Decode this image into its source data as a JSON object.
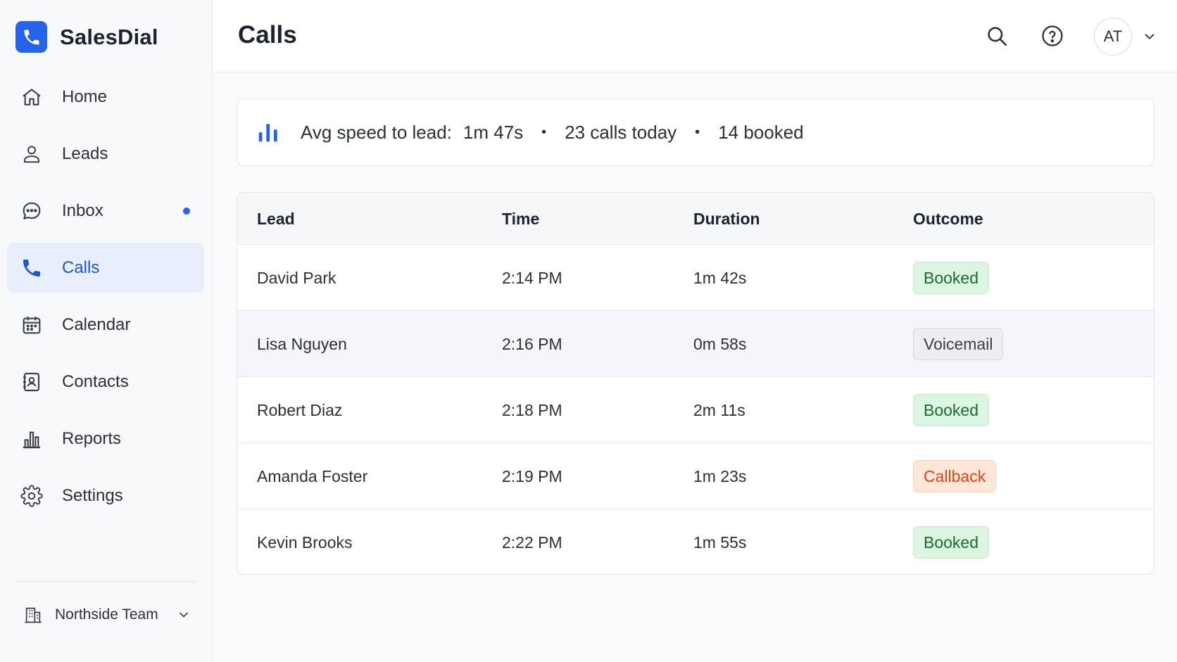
{
  "app": {
    "name": "SalesDial",
    "brand_color": "#2563eb"
  },
  "sidebar": {
    "items": [
      {
        "label": "Home",
        "icon": "home-icon",
        "active": false
      },
      {
        "label": "Leads",
        "icon": "user-icon",
        "active": false
      },
      {
        "label": "Inbox",
        "icon": "chat-icon",
        "active": false,
        "unread_dot": true
      },
      {
        "label": "Calls",
        "icon": "phone-icon",
        "active": true
      },
      {
        "label": "Calendar",
        "icon": "calendar-icon",
        "active": false
      },
      {
        "label": "Contacts",
        "icon": "contact-book-icon",
        "active": false
      },
      {
        "label": "Reports",
        "icon": "bar-chart-icon",
        "active": false
      },
      {
        "label": "Settings",
        "icon": "gear-icon",
        "active": false
      }
    ],
    "team": {
      "label": "Northside Team",
      "icon": "building-icon"
    }
  },
  "header": {
    "title": "Calls",
    "avatar_initials": "AT"
  },
  "stats": {
    "label": "Avg speed to lead:",
    "speed": "1m 47s",
    "calls": "23 calls today",
    "booked": "14 booked",
    "separator": "•"
  },
  "table": {
    "columns": [
      "Lead",
      "Time",
      "Duration",
      "Outcome"
    ],
    "rows": [
      {
        "lead": "David Park",
        "time": "2:14 PM",
        "duration": "1m 42s",
        "outcome": "Booked",
        "status": "booked"
      },
      {
        "lead": "Lisa Nguyen",
        "time": "2:16 PM",
        "duration": "0m 58s",
        "outcome": "Voicemail",
        "status": "voicemail"
      },
      {
        "lead": "Robert Diaz",
        "time": "2:18 PM",
        "duration": "2m 11s",
        "outcome": "Booked",
        "status": "booked"
      },
      {
        "lead": "Amanda Foster",
        "time": "2:19 PM",
        "duration": "1m 23s",
        "outcome": "Callback",
        "status": "callback"
      },
      {
        "lead": "Kevin Brooks",
        "time": "2:22 PM",
        "duration": "1m 55s",
        "outcome": "Booked",
        "status": "booked"
      }
    ]
  },
  "colors": {
    "booked": "#1b6a32",
    "voicemail": "#3a3f49",
    "callback": "#d9461a",
    "active_nav_bg": "#e8eefb"
  }
}
